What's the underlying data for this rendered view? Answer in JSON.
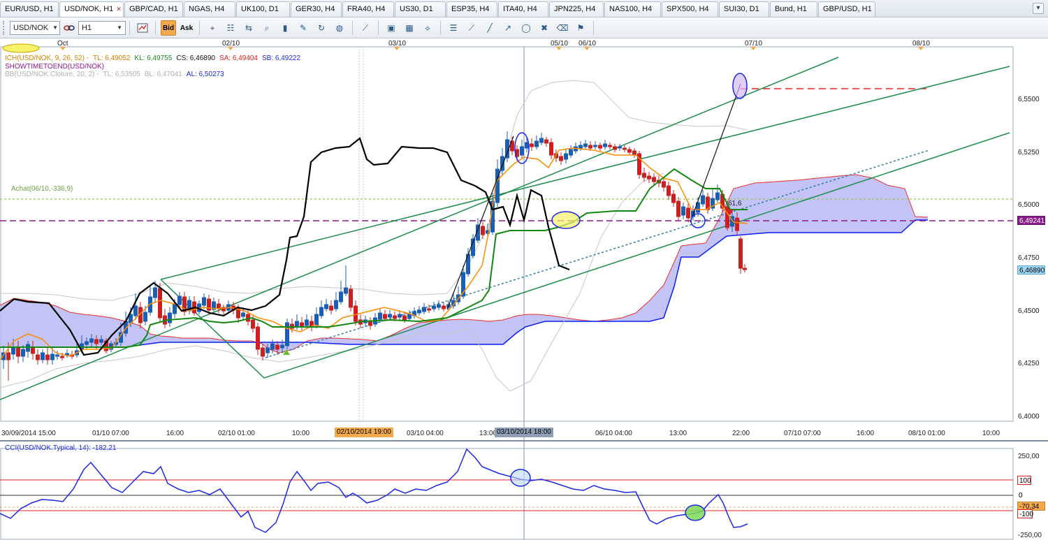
{
  "tabs": [
    {
      "label": "EUR/USD, H1",
      "active": false,
      "w": 84
    },
    {
      "label": "USD/NOK, H1",
      "active": true,
      "w": 92
    },
    {
      "label": "GBP/CAD, H1",
      "active": false,
      "w": 84
    },
    {
      "label": "NGAS, H4",
      "active": false,
      "w": 74
    },
    {
      "label": "UK100, D1",
      "active": false,
      "w": 77
    },
    {
      "label": "GER30, H4",
      "active": false,
      "w": 73
    },
    {
      "label": "FRA40, H4",
      "active": false,
      "w": 74
    },
    {
      "label": "US30, D1",
      "active": false,
      "w": 73
    },
    {
      "label": "ESP35, H4",
      "active": false,
      "w": 73
    },
    {
      "label": "ITA40, H4",
      "active": false,
      "w": 72
    },
    {
      "label": "JPN225, H4",
      "active": false,
      "w": 78
    },
    {
      "label": "NAS100, H4",
      "active": false,
      "w": 81
    },
    {
      "label": "SPX500, H4",
      "active": false,
      "w": 81
    },
    {
      "label": "SUI30, D1",
      "active": false,
      "w": 72
    },
    {
      "label": "Bund, H1",
      "active": false,
      "w": 68
    },
    {
      "label": "GBP/USD, H1",
      "active": false,
      "w": 82
    }
  ],
  "toolbar": {
    "symbol": "USD/NOK",
    "timeframe": "H1",
    "bid_label": "Bid",
    "ask_label": "Ask"
  },
  "indicators": {
    "ichimoku": {
      "name": "ICH(USD/NOK, 9, 26, 52) -",
      "tl": "TL: 6,49052",
      "kl": "KL: 6,49755",
      "cs": "CS: 6,46890",
      "sa": "SA: 6,49404",
      "sb": "SB: 6,49222"
    },
    "showtime": "SHOWTIMETOEND(USD/NOK)",
    "bollinger": {
      "name": "BB(USD/NOK.Cloture, 20, 2) -",
      "tl": "TL: 6,53505",
      "bl": "BL: 6,47041",
      "al": "AL: 6,50273"
    },
    "cci": "CCI(USD/NOK.Typical, 14): -182,21"
  },
  "annotations": {
    "achat": "Achat(06/10,-336,9)",
    "fib": "61,6"
  },
  "price_axis": [
    "6,5500",
    "6,5250",
    "6,5000",
    "6,4750",
    "6,4500",
    "6,4250",
    "6,4000"
  ],
  "price_tags": {
    "order_line": "6,49241",
    "current": "6,46890"
  },
  "cci_axis": [
    "250,00",
    "100",
    "0",
    "-100",
    "-250,00"
  ],
  "cci_tag": "-70,34",
  "top_dates": [
    "Oct",
    "02/10",
    "03/10",
    "05/10",
    "06/10",
    "07/10",
    "08/10"
  ],
  "time_axis": [
    "30/09/2014 15:00",
    "01/10 07:00",
    "16:00",
    "02/10 01:00",
    "10:00",
    "03/10 04:00",
    "13:00",
    "06/10 04:00",
    "13:00",
    "22:00",
    "07/10 07:00",
    "16:00",
    "08/10 01:00",
    "10:00"
  ],
  "highlighted_times": [
    "02/10/2014 19:00",
    "03/10/2014 18:00"
  ],
  "colors": {
    "up_candle": "#1a5fb4",
    "down_candle": "#cc1f1f",
    "tenkan": "#ff8c00",
    "kijun": "#118811",
    "chikou": "#000000",
    "cloud": "#b9b9f3",
    "senkou_a": "#e8312f",
    "senkou_b": "#0a1ff0",
    "channel": "#1e8c4a",
    "order_line": "#8b1a8b",
    "cci_line": "#1a28e6"
  }
}
